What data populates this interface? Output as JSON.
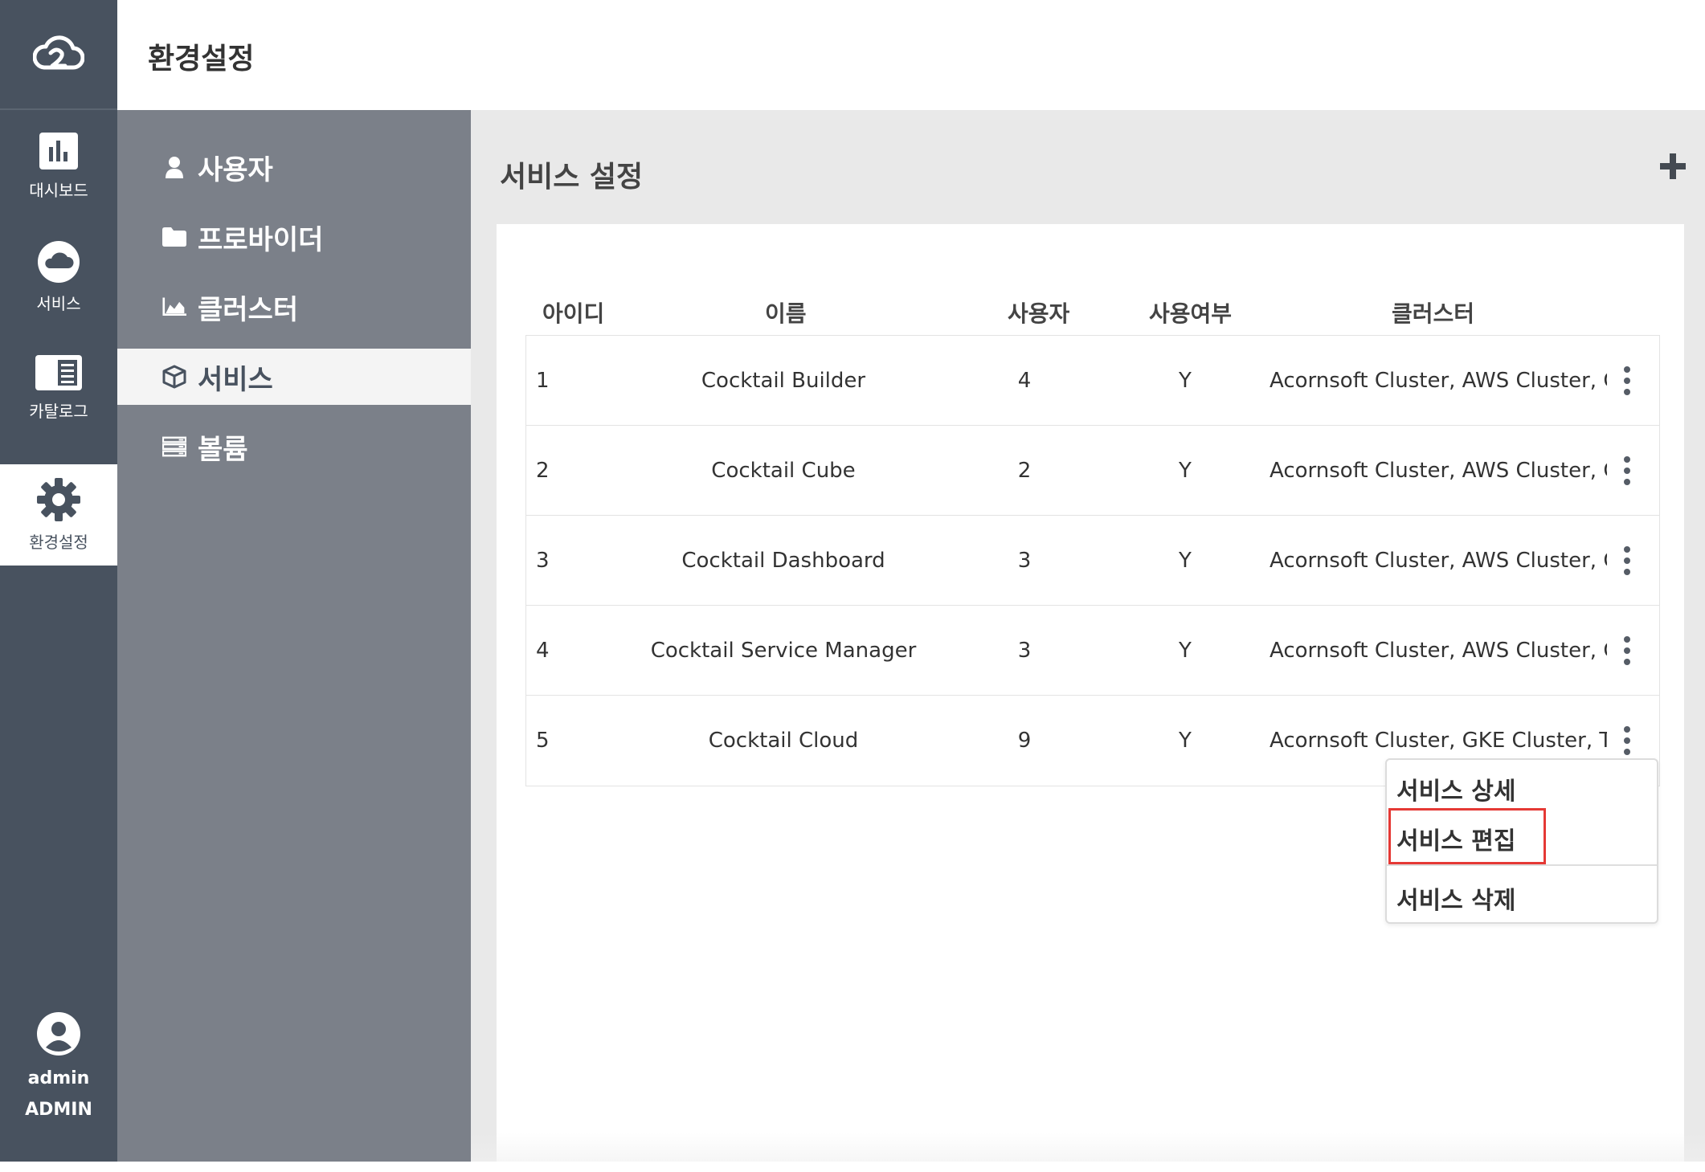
{
  "app": {
    "logo_icon": "cloud-logo-icon",
    "accent": "#48525f",
    "subnav_bg": "#7b8089",
    "highlight_color": "#e53935"
  },
  "rail": {
    "items": [
      {
        "label": "대시보드",
        "icon": "bar-chart-icon"
      },
      {
        "label": "서비스",
        "icon": "cloud-icon"
      },
      {
        "label": "카탈로그",
        "icon": "catalog-icon"
      },
      {
        "label": "환경설정",
        "icon": "gear-icon",
        "active": true
      }
    ],
    "user": {
      "name": "admin",
      "role": "ADMIN",
      "icon": "user-circle-icon"
    }
  },
  "header": {
    "title": "환경설정"
  },
  "subnav": {
    "items": [
      {
        "label": "사용자",
        "icon": "user-icon"
      },
      {
        "label": "프로바이더",
        "icon": "folder-icon"
      },
      {
        "label": "클러스터",
        "icon": "area-chart-icon"
      },
      {
        "label": "서비스",
        "icon": "cube-icon",
        "active": true
      },
      {
        "label": "볼륨",
        "icon": "storage-icon"
      }
    ]
  },
  "main": {
    "title": "서비스 설정",
    "add_icon": "plus-icon",
    "columns": [
      "아이디",
      "이름",
      "사용자",
      "사용여부",
      "클러스터"
    ],
    "rows": [
      {
        "id": "1",
        "name": "Cocktail Builder",
        "users": "4",
        "enabled": "Y",
        "clusters": "Acornsoft Cluster, AWS Cluster, G..."
      },
      {
        "id": "2",
        "name": "Cocktail Cube",
        "users": "2",
        "enabled": "Y",
        "clusters": "Acornsoft Cluster, AWS Cluster, G..."
      },
      {
        "id": "3",
        "name": "Cocktail Dashboard",
        "users": "3",
        "enabled": "Y",
        "clusters": "Acornsoft Cluster, AWS Cluster, G..."
      },
      {
        "id": "4",
        "name": "Cocktail Service Manager",
        "users": "3",
        "enabled": "Y",
        "clusters": "Acornsoft Cluster, AWS Cluster, G..."
      },
      {
        "id": "5",
        "name": "Cocktail Cloud",
        "users": "9",
        "enabled": "Y",
        "clusters": "Acornsoft Cluster, GKE Cluster, T..."
      }
    ],
    "menu": {
      "detail": "서비스 상세",
      "edit": "서비스 편집",
      "delete": "서비스 삭제"
    }
  }
}
